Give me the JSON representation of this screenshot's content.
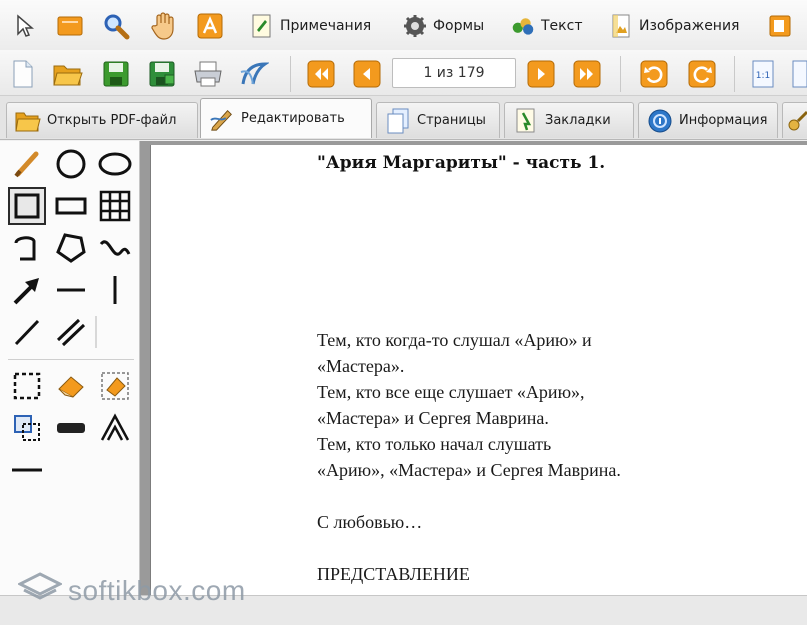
{
  "toolbar_top": {
    "annotations_label": "Примечания",
    "forms_label": "Формы",
    "text_label": "Текст",
    "images_label": "Изображения"
  },
  "navigation": {
    "page_indicator": "1 из 179"
  },
  "tabs": [
    {
      "label": "Открыть PDF-файл",
      "icon": "open-folder-icon"
    },
    {
      "label": "Редактировать",
      "icon": "edit-pencil-icon",
      "active": true
    },
    {
      "label": "Страницы",
      "icon": "pages-icon"
    },
    {
      "label": "Закладки",
      "icon": "bookmarks-icon"
    },
    {
      "label": "Информация",
      "icon": "info-icon"
    }
  ],
  "document": {
    "title": "\"Ария Маргариты\" - часть 1.",
    "lines": [
      "Тем, кто когда-то слушал «Арию» и",
      "«Мастера».",
      "Тем, кто все еще слушает «Арию»,",
      "«Мастера» и Сергея Маврина.",
      "Тем, кто только начал слушать",
      "«Арию», «Мастера» и Сергея Маврина.",
      "С любовью…",
      "ПРЕДСТАВЛЕНИЕ"
    ]
  },
  "watermark": {
    "text": "softikbox.com"
  },
  "colors": {
    "accent_orange": "#f39a1e",
    "green": "#3c9a2e",
    "page_bg": "#ffffff",
    "canvas_bg": "#9a9a9a"
  }
}
